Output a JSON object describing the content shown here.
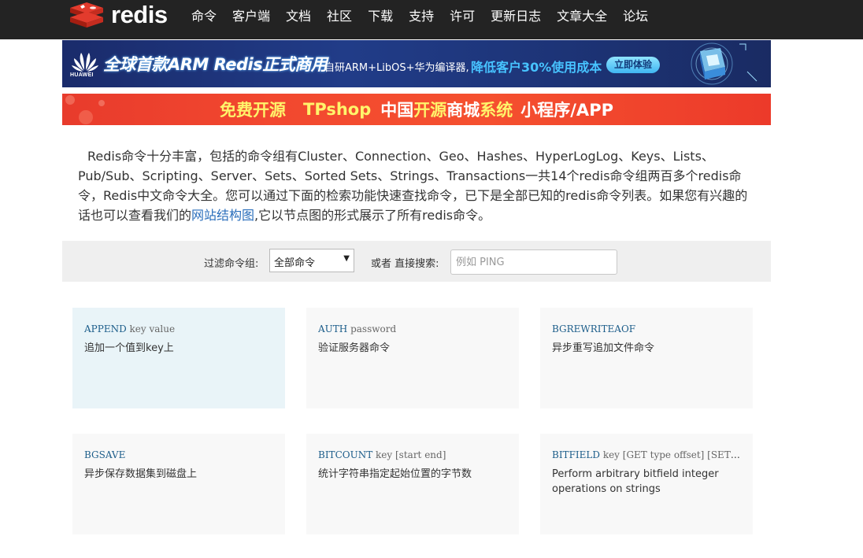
{
  "nav": {
    "logo_text": "redis",
    "items": [
      "命令",
      "客户端",
      "文档",
      "社区",
      "下载",
      "支持",
      "许可",
      "更新日志",
      "文章大全",
      "论坛"
    ]
  },
  "banner1": {
    "brand": "HUAWEI",
    "title": "全球首款ARM Redis正式商用",
    "subtitle": "自研ARM+LibOS+华为编译器,",
    "highlight": "降低客户30%使用成本",
    "button": "立即体验"
  },
  "banner2": {
    "parts": [
      "免费开源",
      "TPshop",
      "中国",
      "开源",
      "商城",
      "系统",
      "小程序/APP"
    ]
  },
  "intro": {
    "text_before_link": "Redis命令十分丰富，包括的命令组有Cluster、Connection、Geo、Hashes、HyperLogLog、Keys、Lists、Pub/Sub、Scripting、Server、Sets、Sorted Sets、Strings、Transactions一共14个redis命令组两百多个redis命令，Redis中文命令大全。您可以通过下面的检索功能快速查找命令，已下是全部已知的redis命令列表。如果您有兴趣的话也可以查看我们的",
    "link_text": "网站结构图",
    "text_after_link": ",它以节点图的形式展示了所有redis命令。"
  },
  "filter": {
    "group_label": "过滤命令组:",
    "group_value": "全部命令",
    "search_label": "或者 直接搜索:",
    "search_placeholder": "例如 PING"
  },
  "commands": [
    {
      "name": "APPEND",
      "args": "key value",
      "desc": "追加一个值到key上",
      "active": true
    },
    {
      "name": "AUTH",
      "args": "password",
      "desc": "验证服务器命令"
    },
    {
      "name": "BGREWRITEAOF",
      "args": "",
      "desc": "异步重写追加文件命令"
    },
    {
      "name": "BGSAVE",
      "args": "",
      "desc": "异步保存数据集到磁盘上"
    },
    {
      "name": "BITCOUNT",
      "args": "key [start end]",
      "desc": "统计字符串指定起始位置的字节数"
    },
    {
      "name": "BITFIELD",
      "args": "key [GET type offset] [SET type offset value]",
      "desc": "Perform arbitrary bitfield integer operations on strings"
    }
  ],
  "colors": {
    "topbar": "#232323",
    "link": "#2a6ebb",
    "command_name": "#1c5d8a",
    "card_bg": "#f8f8f8",
    "card_active_bg": "#e9f4f8"
  }
}
